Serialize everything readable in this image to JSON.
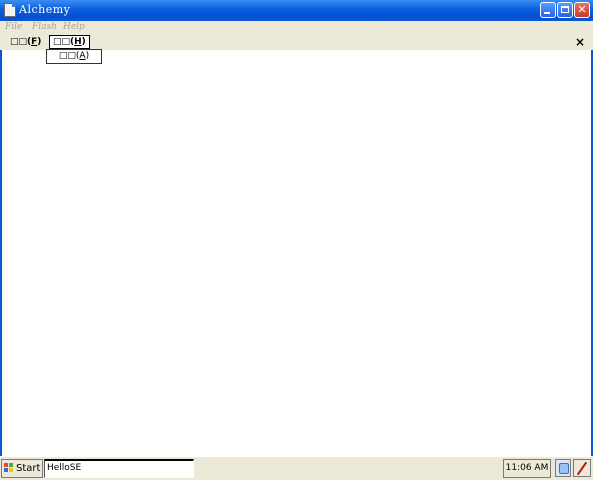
{
  "window": {
    "title": "Alchemy"
  },
  "native_menu": {
    "items": [
      "File",
      "Flash",
      "Help"
    ]
  },
  "app_menu": {
    "file_label": "□□(",
    "file_mnemonic": "F",
    "help_label": "□□(",
    "help_mnemonic": "H",
    "close_glyph": "×"
  },
  "dropdown": {
    "item_label": "□□(",
    "item_mnemonic": "A"
  },
  "taskbar": {
    "start_label": "Start",
    "task_label": "HelloSE",
    "clock": "11:06 AM"
  },
  "colors": {
    "titlebar": "#0a56cf",
    "face": "#ece9d8"
  }
}
